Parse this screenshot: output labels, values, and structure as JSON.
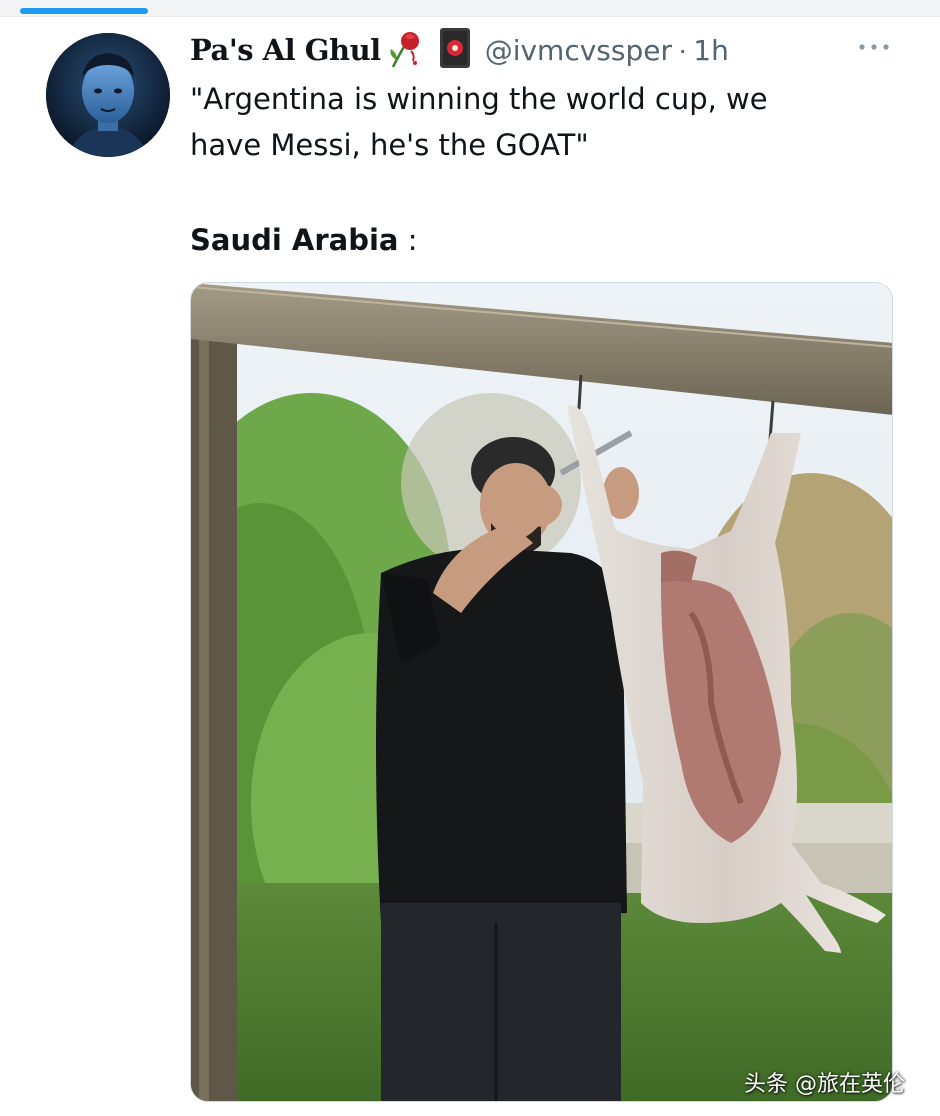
{
  "tweet": {
    "display_name": "Pa's Al Ghul",
    "name_emojis": [
      "rose-emoji",
      "flower-playing-card-emoji"
    ],
    "handle": "@ivmcvssper",
    "separator": "·",
    "timestamp": "1h",
    "text_lines": [
      "\"Argentina is winning the world cup, we",
      "have Messi, he's the GOAT\""
    ],
    "caption_bold": "Saudi Arabia",
    "caption_rest": " :"
  },
  "media": {
    "description_icon": "photo-man-butchering-hanging-lamb"
  },
  "watermark": {
    "text": "头条 @旅在英伦"
  },
  "colors": {
    "accent": "#1d9bf0",
    "text_primary": "#0f1419",
    "text_secondary": "#536471"
  },
  "icons": {
    "more": "more-horizontal-icon"
  }
}
